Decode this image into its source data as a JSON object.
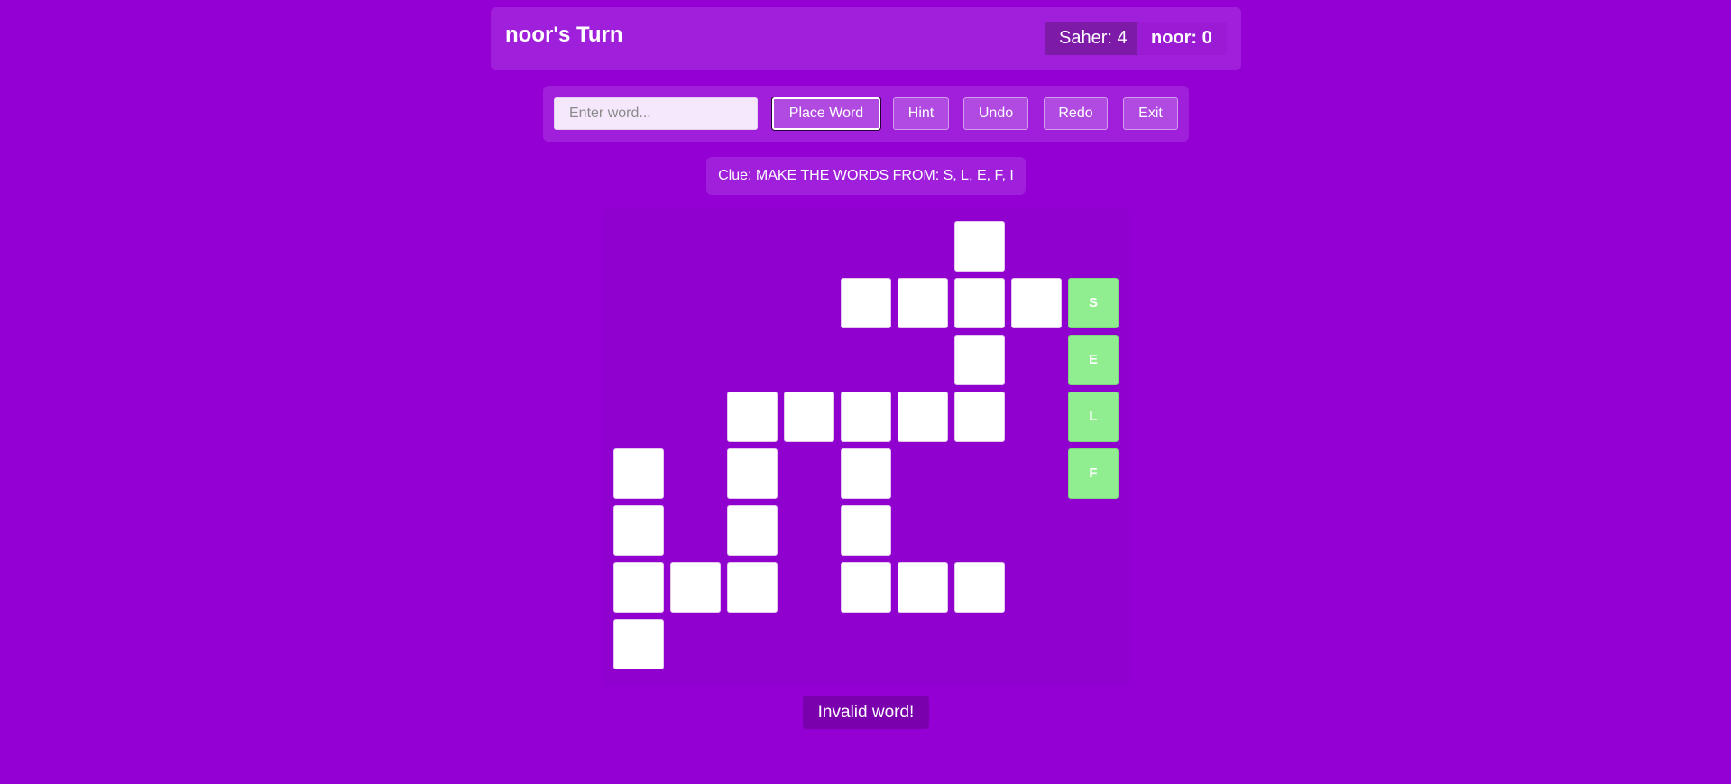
{
  "header": {
    "turn_title": "noor's Turn",
    "scores": [
      {
        "label": "Saher: 4"
      },
      {
        "label": "noor: 0"
      }
    ]
  },
  "controls": {
    "input_placeholder": "Enter word...",
    "input_value": "",
    "place_word": "Place Word",
    "hint": "Hint",
    "undo": "Undo",
    "redo": "Redo",
    "exit": "Exit"
  },
  "clue": "Clue: MAKE THE WORDS FROM: S, L, E, F, I",
  "message": "Invalid word!",
  "colors": {
    "background": "#9400d3",
    "panel": "#a01fdb",
    "cell_empty": "#ffffff",
    "cell_filled": "#90ee90"
  },
  "grid": {
    "rows": 8,
    "cols": 9,
    "cells": [
      {
        "r": 0,
        "c": 6,
        "letter": ""
      },
      {
        "r": 1,
        "c": 4,
        "letter": ""
      },
      {
        "r": 1,
        "c": 5,
        "letter": ""
      },
      {
        "r": 1,
        "c": 6,
        "letter": ""
      },
      {
        "r": 1,
        "c": 7,
        "letter": ""
      },
      {
        "r": 1,
        "c": 8,
        "letter": "S"
      },
      {
        "r": 2,
        "c": 6,
        "letter": ""
      },
      {
        "r": 2,
        "c": 8,
        "letter": "E"
      },
      {
        "r": 3,
        "c": 2,
        "letter": ""
      },
      {
        "r": 3,
        "c": 3,
        "letter": ""
      },
      {
        "r": 3,
        "c": 4,
        "letter": ""
      },
      {
        "r": 3,
        "c": 5,
        "letter": ""
      },
      {
        "r": 3,
        "c": 6,
        "letter": ""
      },
      {
        "r": 3,
        "c": 8,
        "letter": "L"
      },
      {
        "r": 4,
        "c": 0,
        "letter": ""
      },
      {
        "r": 4,
        "c": 2,
        "letter": ""
      },
      {
        "r": 4,
        "c": 4,
        "letter": ""
      },
      {
        "r": 4,
        "c": 8,
        "letter": "F"
      },
      {
        "r": 5,
        "c": 0,
        "letter": ""
      },
      {
        "r": 5,
        "c": 2,
        "letter": ""
      },
      {
        "r": 5,
        "c": 4,
        "letter": ""
      },
      {
        "r": 6,
        "c": 0,
        "letter": ""
      },
      {
        "r": 6,
        "c": 1,
        "letter": ""
      },
      {
        "r": 6,
        "c": 2,
        "letter": ""
      },
      {
        "r": 6,
        "c": 4,
        "letter": ""
      },
      {
        "r": 6,
        "c": 5,
        "letter": ""
      },
      {
        "r": 6,
        "c": 6,
        "letter": ""
      },
      {
        "r": 7,
        "c": 0,
        "letter": ""
      }
    ]
  }
}
